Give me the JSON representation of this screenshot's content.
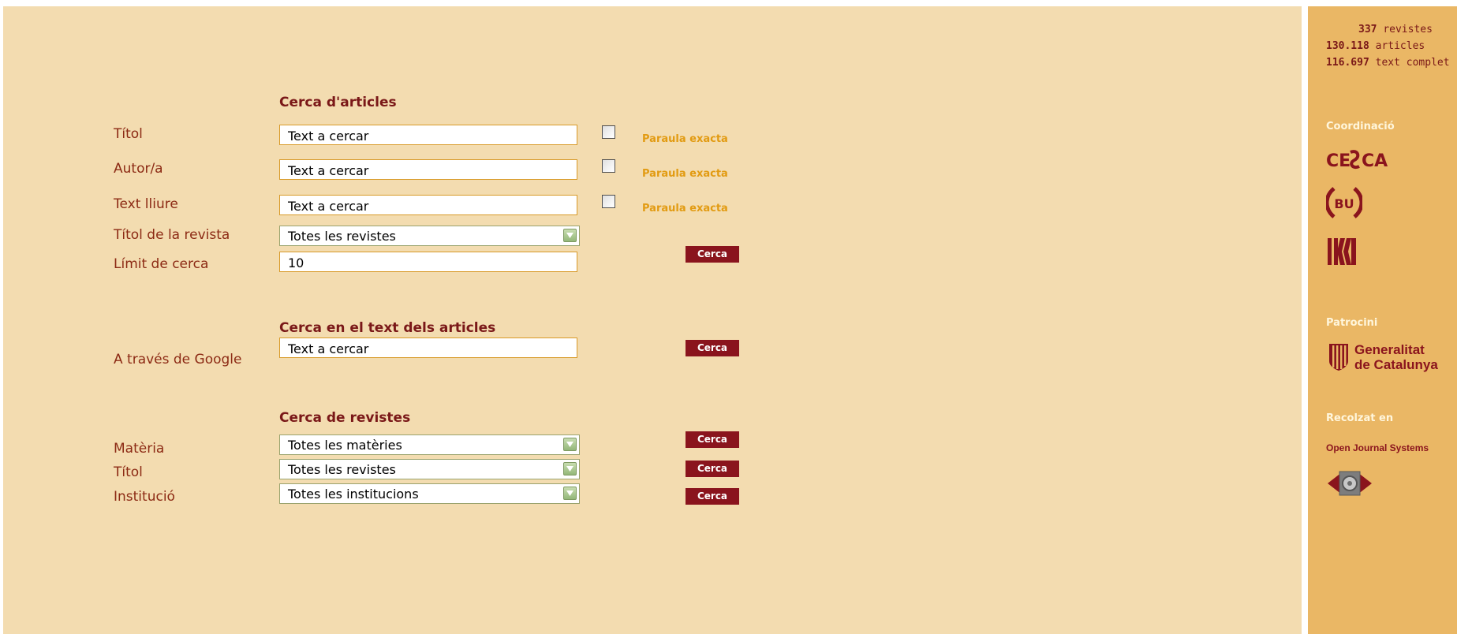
{
  "articles_search": {
    "heading": "Cerca d'articles",
    "title_label": "Títol",
    "author_label": "Autor/a",
    "freetext_label": "Text lliure",
    "journal_label": "Títol de la revista",
    "limit_label": "Límit de cerca",
    "input_value": "Text a cercar",
    "exact_label": "Paraula exacta",
    "journal_select": "Totes les revistes",
    "limit_value": "10",
    "search_button": "Cerca"
  },
  "google_search": {
    "heading": "Cerca en el text dels articles",
    "label": "A través de Google",
    "input_value": "Text a cercar",
    "search_button": "Cerca"
  },
  "journal_search": {
    "heading": "Cerca de revistes",
    "subject_label": "Matèria",
    "subject_select": "Totes les matèries",
    "title_label": "Títol",
    "title_select": "Totes les revistes",
    "institution_label": "Institució",
    "institution_select": "Totes les institucions",
    "search_button": "Cerca"
  },
  "sidebar": {
    "stats": [
      {
        "count": "337",
        "label": "revistes"
      },
      {
        "count": "130.118",
        "label": "articles"
      },
      {
        "count": "116.697",
        "label": "text complet"
      }
    ],
    "coordination_heading": "Coordinació",
    "logos": {
      "cesca": "CESCA",
      "bu": "BU",
      "generalitat_line1": "Generalitat",
      "generalitat_line2": "de Catalunya",
      "ojs": "Open Journal Systems"
    },
    "sponsorship_heading": "Patrocini",
    "built_on_heading": "Recolzat en"
  },
  "colors": {
    "main_background": "#f3dcb0",
    "sidebar_background": "#eab765",
    "button": "#8a141d",
    "label": "#8c2a14",
    "accent": "#e29b12"
  }
}
